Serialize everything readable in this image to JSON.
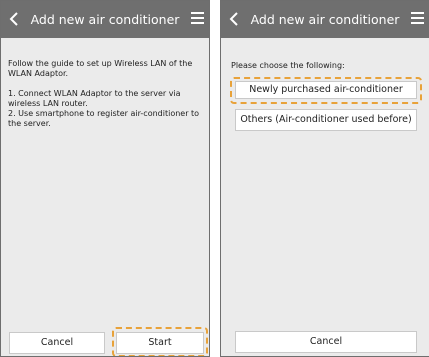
{
  "left_screen": {
    "title": "Add new air conditioner",
    "icons": {
      "back": "chevron-left-icon",
      "menu": "hamburger-menu-icon"
    },
    "guide_intro": "Follow the guide to set up Wireless LAN of the WLAN Adaptor.",
    "step_1": "1. Connect WLAN Adaptor to the server via wireless LAN router.",
    "step_2": "2. Use smartphone to register air-conditioner to the server.",
    "cancel_label": "Cancel",
    "start_label": "Start"
  },
  "right_screen": {
    "title": "Add new air conditioner",
    "icons": {
      "back": "chevron-left-icon",
      "menu": "hamburger-menu-icon"
    },
    "prompt": "Please choose the following:",
    "option_new": "Newly purchased air-conditioner",
    "option_others": "Others (Air-conditioner used before)",
    "cancel_label": "Cancel"
  },
  "colors": {
    "header": "#6f6f6f",
    "background": "#ebebeb",
    "highlight": "#e8a23a",
    "button": "#ffffff"
  }
}
